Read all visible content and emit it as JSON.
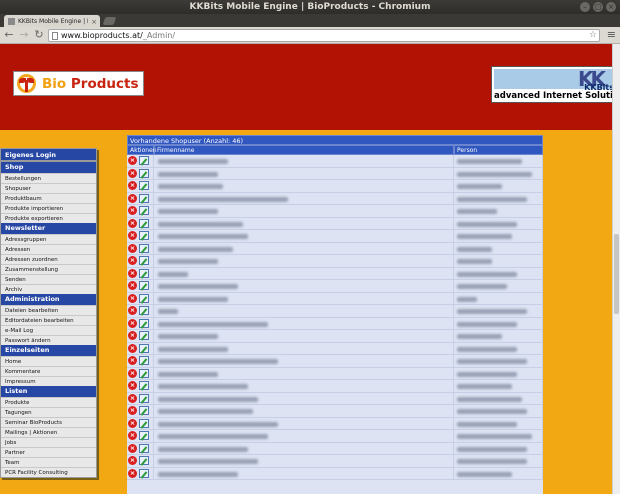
{
  "window": {
    "title": "KKBits Mobile Engine | BioProducts - Chromium"
  },
  "tab": {
    "label": "KKBits Mobile Engine | Bi",
    "close": "×"
  },
  "toolbar": {
    "back": "←",
    "forward": "→",
    "reload": "↻",
    "url_host": "www.bioproducts.at/",
    "url_path": "_Admin/",
    "star": "☆",
    "menu": "≡"
  },
  "header": {
    "logo_bio": "Bio",
    "logo_products": " Products",
    "kk_mark": "KK",
    "kk_name": "KKBits",
    "kk_tagline": "advanced Internet Solutions",
    "colors": {
      "banner": "#b11204",
      "page_bg": "#f2a812",
      "nav_blue": "#2747a4"
    }
  },
  "sidebar": {
    "login": "Eigenes Login",
    "sections": [
      {
        "title": "Shop",
        "items": [
          "Bestellungen",
          "Shopuser",
          "Produktbaum",
          "Produkte importieren",
          "Produkte exportieren"
        ]
      },
      {
        "title": "Newsletter",
        "items": [
          "Adressgruppen",
          "Adressen",
          "Adressen zuordnen",
          "Zusammenstellung",
          "Senden",
          "Archiv"
        ]
      },
      {
        "title": "Administration",
        "items": [
          "Dateien bearbeiten",
          "Editordateien bearbeiten",
          "e-Mail Log",
          "Passwort ändern"
        ]
      },
      {
        "title": "Einzelseiten",
        "items": [
          "Home",
          "Kommentare",
          "Impressum"
        ]
      },
      {
        "title": "Listen",
        "items": [
          "Produkte",
          "Tagungen",
          "Seminar BioProducts",
          "Mailings | Aktionen",
          "Jobs",
          "Partner",
          "Team",
          "PCR Facility Consulting"
        ]
      }
    ]
  },
  "table": {
    "title": "Vorhandene Shopuser (Anzahl: 46)",
    "columns": [
      "Aktionen",
      "Firmenname",
      "Person"
    ],
    "row_count": 26
  }
}
